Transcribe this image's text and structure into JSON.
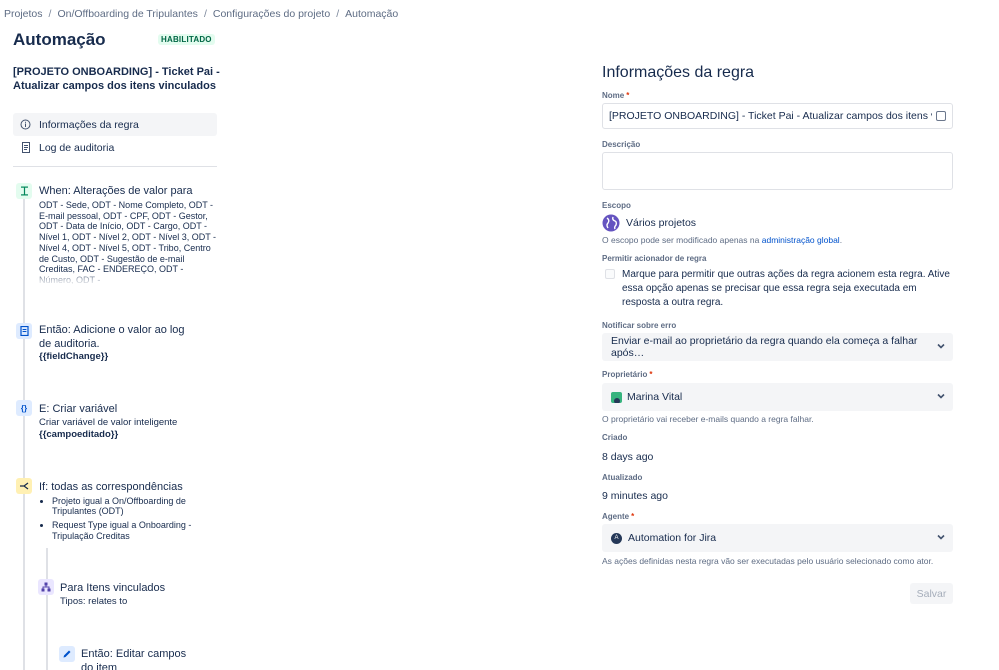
{
  "breadcrumb": [
    "Projetos",
    "On/Offboarding de Tripulantes",
    "Configurações do projeto",
    "Automação"
  ],
  "header": {
    "title": "Automação",
    "badge": "HABILITADO"
  },
  "rule": {
    "name": "[PROJETO ONBOARDING] - Ticket Pai - Atualizar campos dos itens vinculados"
  },
  "nav": [
    {
      "label": "Informações da regra",
      "icon": "info-icon",
      "active": true
    },
    {
      "label": "Log de auditoria",
      "icon": "audit-log-icon",
      "active": false
    }
  ],
  "flow": {
    "trigger": {
      "title": "When: Alterações de valor para",
      "fields": "ODT - Sede, ODT - Nome Completo, ODT - E-mail pessoal, ODT - CPF, ODT - Gestor, ODT - Data de Início, ODT - Cargo, ODT - Nível 1, ODT - Nível 2, ODT - Nível 3, ODT - Nível 4, ODT - Nível 5, ODT - Tribo, Centro de Custo, ODT - Sugestão de e-mail Creditas, FAC - ENDEREÇO, ODT - Número, ODT -"
    },
    "action_log": {
      "title": "Então: Adicione o valor ao log de auditoria.",
      "value": "{{fieldChange}}"
    },
    "variable": {
      "title": "E: Criar variável",
      "subtitle": "Criar variável de valor inteligente",
      "value": "{{campoeditado}}"
    },
    "condition": {
      "title": "If: todas as correspondências",
      "items": [
        "Projeto igual a On/Offboarding de Tripulantes (ODT)",
        "Request Type igual a Onboarding - Tripulação Creditas"
      ]
    },
    "branch": {
      "title": "Para Itens vinculados",
      "subtitle": "Tipos: relates to"
    },
    "edit": {
      "title": "Então: Editar campos do item"
    }
  },
  "panel": {
    "title": "Informações da regra",
    "name_label": "Nome",
    "name_value": "[PROJETO ONBOARDING] - Ticket Pai - Atualizar campos dos itens vinculados",
    "description_label": "Descrição",
    "scope_label": "Escopo",
    "scope_value": "Vários projetos",
    "scope_help": "O escopo pode ser modificado apenas na",
    "scope_help_link": "administração global",
    "scope_help_end": ".",
    "allow_label": "Permitir acionador de regra",
    "allow_text": "Marque para permitir que outras ações da regra acionem esta regra. Ative essa opção apenas se precisar que essa regra seja executada em resposta a outra regra.",
    "notify_label": "Notificar sobre erro",
    "notify_value": "Enviar e-mail ao proprietário da regra quando ela começa a falhar após…",
    "owner_label": "Proprietário",
    "owner_value": "Marina Vital",
    "owner_help": "O proprietário vai receber e-mails quando a regra falhar.",
    "created_label": "Criado",
    "created_value": "8 days ago",
    "updated_label": "Atualizado",
    "updated_value": "9 minutes ago",
    "agent_label": "Agente",
    "agent_value": "Automation for Jira",
    "agent_help": "As ações definidas nesta regra vão ser executadas pelo usuário selecionado como ator.",
    "save_label": "Salvar"
  },
  "colors": {
    "accent": "#0052cc",
    "required": "#de350b",
    "badge_bg": "#e3fcef",
    "badge_text": "#006644"
  }
}
